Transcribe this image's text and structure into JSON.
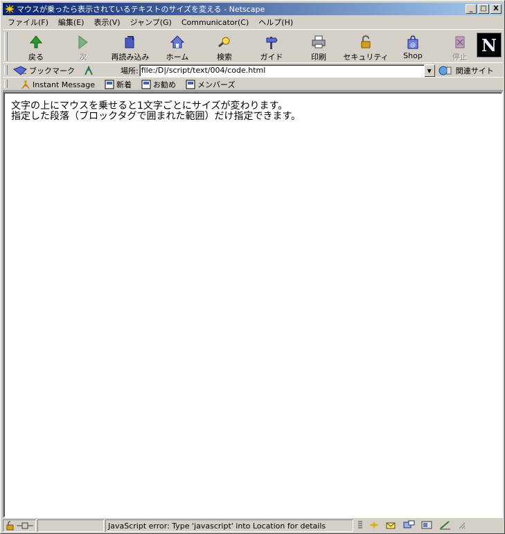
{
  "window": {
    "title": "マウスが乗ったら表示されているテキストのサイズを変える - Netscape",
    "buttons": {
      "minimize": "_",
      "maximize": "□",
      "close": "X"
    }
  },
  "menu": [
    "ファイル(F)",
    "編集(E)",
    "表示(V)",
    "ジャンプ(G)",
    "Communicator(C)",
    "ヘルプ(H)"
  ],
  "nav": [
    {
      "id": "back",
      "label": "戻る",
      "icon": "back-arrow-icon",
      "enabled": true
    },
    {
      "id": "forward",
      "label": "次",
      "icon": "forward-arrow-icon",
      "enabled": false
    },
    {
      "id": "reload",
      "label": "再読み込み",
      "icon": "reload-icon",
      "enabled": true
    },
    {
      "id": "home",
      "label": "ホーム",
      "icon": "home-icon",
      "enabled": true
    },
    {
      "id": "search",
      "label": "検索",
      "icon": "search-icon",
      "enabled": true
    },
    {
      "id": "guide",
      "label": "ガイド",
      "icon": "guide-icon",
      "enabled": true
    },
    {
      "id": "print",
      "label": "印刷",
      "icon": "printer-icon",
      "enabled": true
    },
    {
      "id": "security",
      "label": "セキュリティ",
      "icon": "lock-icon",
      "enabled": true
    },
    {
      "id": "shop",
      "label": "Shop",
      "icon": "shop-bag-icon",
      "enabled": true
    },
    {
      "id": "stop",
      "label": "停止",
      "icon": "stop-icon",
      "enabled": false
    }
  ],
  "location": {
    "bookmarks_label": "ブックマーク",
    "label": "場所:",
    "url": "file:/D|/script/text/004/code.html",
    "related_label": "関連サイト"
  },
  "personal_toolbar": [
    {
      "label": "Instant Message",
      "icon": "instant-message-icon"
    },
    {
      "label": "新着",
      "icon": "bookmark-page-icon"
    },
    {
      "label": "お勧め",
      "icon": "bookmark-page-icon"
    },
    {
      "label": "メンバーズ",
      "icon": "bookmark-page-icon"
    }
  ],
  "content": {
    "lines": [
      "文字の上にマウスを乗せると1文字ごとにサイズが変わります。",
      "指定した段落（ブロックタグで囲まれた範囲）だけ指定できます。"
    ]
  },
  "status": {
    "message": "JavaScript error: Type 'javascript' into Location for details"
  }
}
